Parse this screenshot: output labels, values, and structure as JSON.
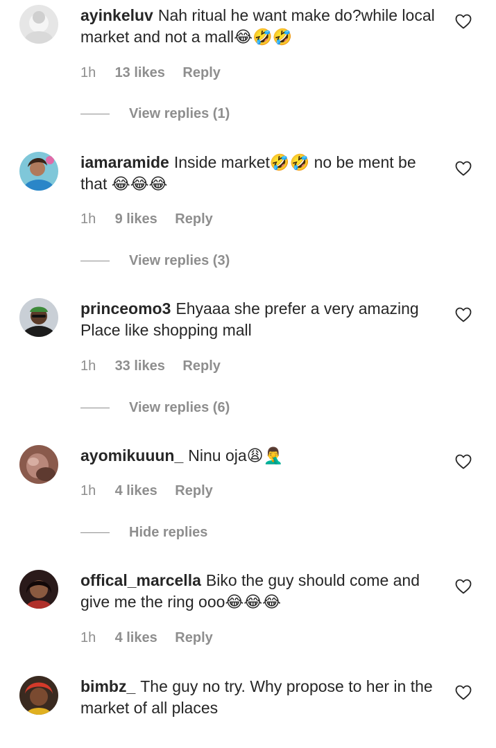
{
  "comments": [
    {
      "username": "ayinkeluv",
      "text": "Nah ritual he want make do?while local market and not a mall😂🤣🤣",
      "time": "1h",
      "likes": "13 likes",
      "reply": "Reply",
      "replies_label": "View replies (1)"
    },
    {
      "username": "iamaramide",
      "text": "Inside market🤣🤣 no be ment be that 😂😂😂",
      "time": "1h",
      "likes": "9 likes",
      "reply": "Reply",
      "replies_label": "View replies (3)"
    },
    {
      "username": "princeomo3",
      "text": "Ehyaaa she prefer a very amazing Place like shopping mall",
      "time": "1h",
      "likes": "33 likes",
      "reply": "Reply",
      "replies_label": "View replies (6)"
    },
    {
      "username": "ayomikuuun_",
      "text": "Ninu oja😩🤦‍♂️",
      "time": "1h",
      "likes": "4 likes",
      "reply": "Reply",
      "replies_label": "Hide replies"
    },
    {
      "username": "offical_marcella",
      "text": "Biko the guy should come and give me the ring ooo😂😂😂",
      "time": "1h",
      "likes": "4 likes",
      "reply": "Reply"
    },
    {
      "username": "bimbz_",
      "text": "The guy no try. Why propose to her in the market of all places"
    }
  ],
  "icons": {
    "like": "heart-outline-icon",
    "avatar": "user-avatar"
  },
  "colors": {
    "text": "#262626",
    "secondary": "#8e8e8e",
    "background": "#ffffff"
  }
}
